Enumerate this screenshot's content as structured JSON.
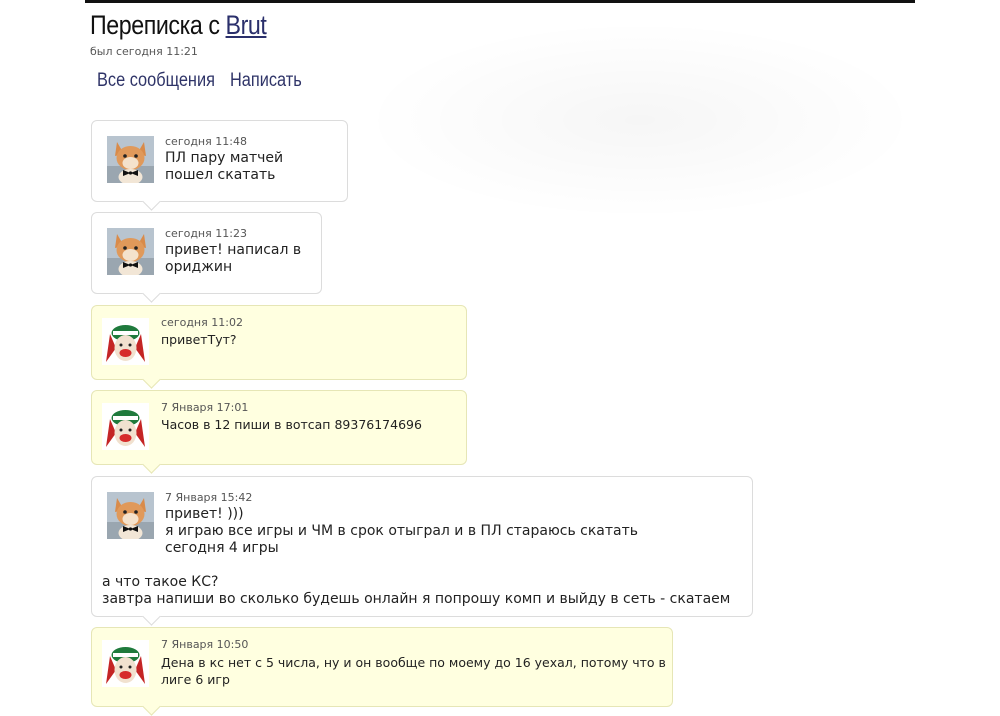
{
  "header": {
    "title_prefix": "Переписка с",
    "username": "Brut",
    "last_seen": "был сегодня 11:21"
  },
  "nav": {
    "all_messages": "Все сообщения",
    "write": "Написать"
  },
  "messages": [
    {
      "direction": "in",
      "avatar": "cat-avatar",
      "time": "сегодня 11:48",
      "text": "ПЛ пару матчей\nпошел скатать"
    },
    {
      "direction": "in",
      "avatar": "cat-avatar",
      "time": "сегодня 11:23",
      "text": "привет! написал в\nориджин"
    },
    {
      "direction": "out",
      "avatar": "clown-avatar",
      "time": "сегодня 11:02",
      "text": "приветТут?"
    },
    {
      "direction": "out",
      "avatar": "clown-avatar",
      "time": "7 Января 17:01",
      "text": "Часов в 12 пиши в вотсап 89376174696"
    },
    {
      "direction": "in",
      "avatar": "cat-avatar",
      "time": "7 Января 15:42",
      "text": "привет! )))\nя играю все игры и ЧМ в срок отыграл и в ПЛ стараюсь скатать\nсегодня 4 игры",
      "extra": "а что такое КС?\nзавтра напиши во сколько будешь онлайн я попрошу комп и выйду в сеть - скатаем"
    },
    {
      "direction": "out",
      "avatar": "clown-avatar",
      "time": "7 Января 10:50",
      "text": "Дена в кс нет с 5 числа, ну и он вообще по моему до 16 уехал, потому что в\nлиге 6 игр"
    }
  ],
  "colors": {
    "incoming_bg": "#ffffff",
    "outgoing_bg": "#ffffe0",
    "link": "#2a2f6b"
  }
}
